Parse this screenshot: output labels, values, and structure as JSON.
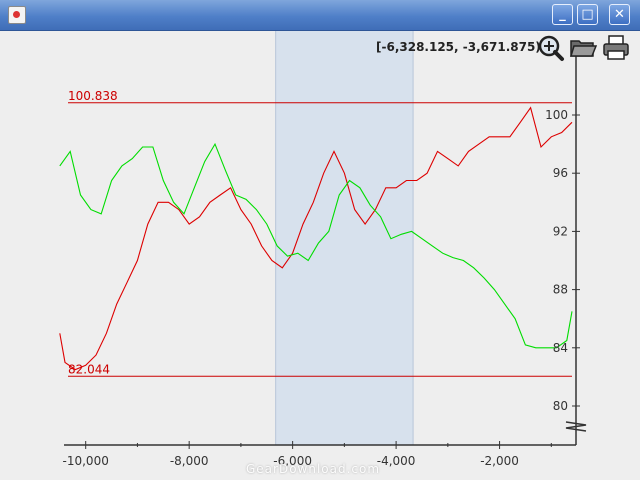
{
  "window": {
    "title": "",
    "buttons": {
      "minimize": "_",
      "maximize": "□",
      "close": "✕"
    },
    "colors": {
      "titlebar": "#4f7fc8",
      "plot_bg": "#eeeeee",
      "selection": "#cfdcec"
    }
  },
  "toolbar": {
    "coordinate_readout": "[-6,328.125, -3,671.875)",
    "tools": [
      "magnifier-icon",
      "folder-open-icon",
      "printer-icon"
    ]
  },
  "watermark": "GearDownload.com",
  "chart_data": {
    "type": "line",
    "x_axis": {
      "range": [
        -10400,
        -600
      ],
      "ticks": [
        -10000,
        -8000,
        -6000,
        -4000,
        -2000
      ],
      "tick_labels": [
        "-10,000",
        "-8,000",
        "-6,000",
        "-4,000",
        "-2,000"
      ]
    },
    "y_axis": {
      "range": [
        78,
        102
      ],
      "ticks": [
        80,
        84,
        88,
        92,
        96,
        100
      ],
      "tick_labels": [
        "80",
        "84",
        "88",
        "92",
        "96",
        "100"
      ],
      "position": "right"
    },
    "selection_range": [
      -6328.125,
      -3671.875
    ],
    "markers": [
      {
        "label": "100.838",
        "value": 100.838,
        "color": "#cc0000"
      },
      {
        "label": "82.044",
        "value": 82.044,
        "color": "#cc0000"
      }
    ],
    "series": [
      {
        "color": "#dd0000",
        "x": [
          -10500,
          -10400,
          -10200,
          -10000,
          -9800,
          -9600,
          -9400,
          -9200,
          -9000,
          -8800,
          -8600,
          -8400,
          -8200,
          -8000,
          -7800,
          -7600,
          -7400,
          -7200,
          -7000,
          -6800,
          -6600,
          -6400,
          -6200,
          -6000,
          -5800,
          -5600,
          -5400,
          -5200,
          -5000,
          -4800,
          -4600,
          -4400,
          -4200,
          -4000,
          -3800,
          -3600,
          -3400,
          -3200,
          -3000,
          -2800,
          -2600,
          -2400,
          -2200,
          -2000,
          -1800,
          -1600,
          -1400,
          -1200,
          -1000,
          -800,
          -600
        ],
        "values": [
          85,
          83,
          82.5,
          82.8,
          83.5,
          85,
          87,
          88.5,
          90,
          92.5,
          94,
          94,
          93.5,
          92.5,
          93,
          94,
          94.5,
          95,
          93.5,
          92.5,
          91,
          90,
          89.5,
          90.5,
          92.5,
          94,
          96,
          97.5,
          96,
          93.5,
          92.5,
          93.5,
          95,
          95,
          95.5,
          95.5,
          96,
          97.5,
          97,
          96.5,
          97.5,
          98,
          98.5,
          98.5,
          98.5,
          99.5,
          100.5,
          97.8,
          98.5,
          98.8,
          99.5
        ]
      },
      {
        "color": "#00dd00",
        "x": [
          -10500,
          -10300,
          -10100,
          -9900,
          -9700,
          -9500,
          -9300,
          -9100,
          -8900,
          -8700,
          -8500,
          -8300,
          -8100,
          -7900,
          -7700,
          -7500,
          -7300,
          -7100,
          -6900,
          -6700,
          -6500,
          -6300,
          -6100,
          -5900,
          -5700,
          -5500,
          -5300,
          -5100,
          -4900,
          -4700,
          -4500,
          -4300,
          -4100,
          -3900,
          -3700,
          -3500,
          -3300,
          -3100,
          -2900,
          -2700,
          -2500,
          -2300,
          -2100,
          -1900,
          -1700,
          -1500,
          -1300,
          -1100,
          -900,
          -700,
          -600
        ],
        "values": [
          96.5,
          97.5,
          94.5,
          93.5,
          93.2,
          95.5,
          96.5,
          97,
          97.8,
          97.8,
          95.5,
          94,
          93.2,
          95,
          96.8,
          98,
          96.2,
          94.5,
          94.2,
          93.5,
          92.5,
          91,
          90.3,
          90.5,
          90,
          91.2,
          92,
          94.5,
          95.5,
          95,
          93.8,
          93,
          91.5,
          91.8,
          92,
          91.5,
          91,
          90.5,
          90.2,
          90,
          89.5,
          88.8,
          88,
          87,
          86,
          84.2,
          84,
          84,
          84,
          84.5,
          86.5
        ]
      }
    ]
  }
}
